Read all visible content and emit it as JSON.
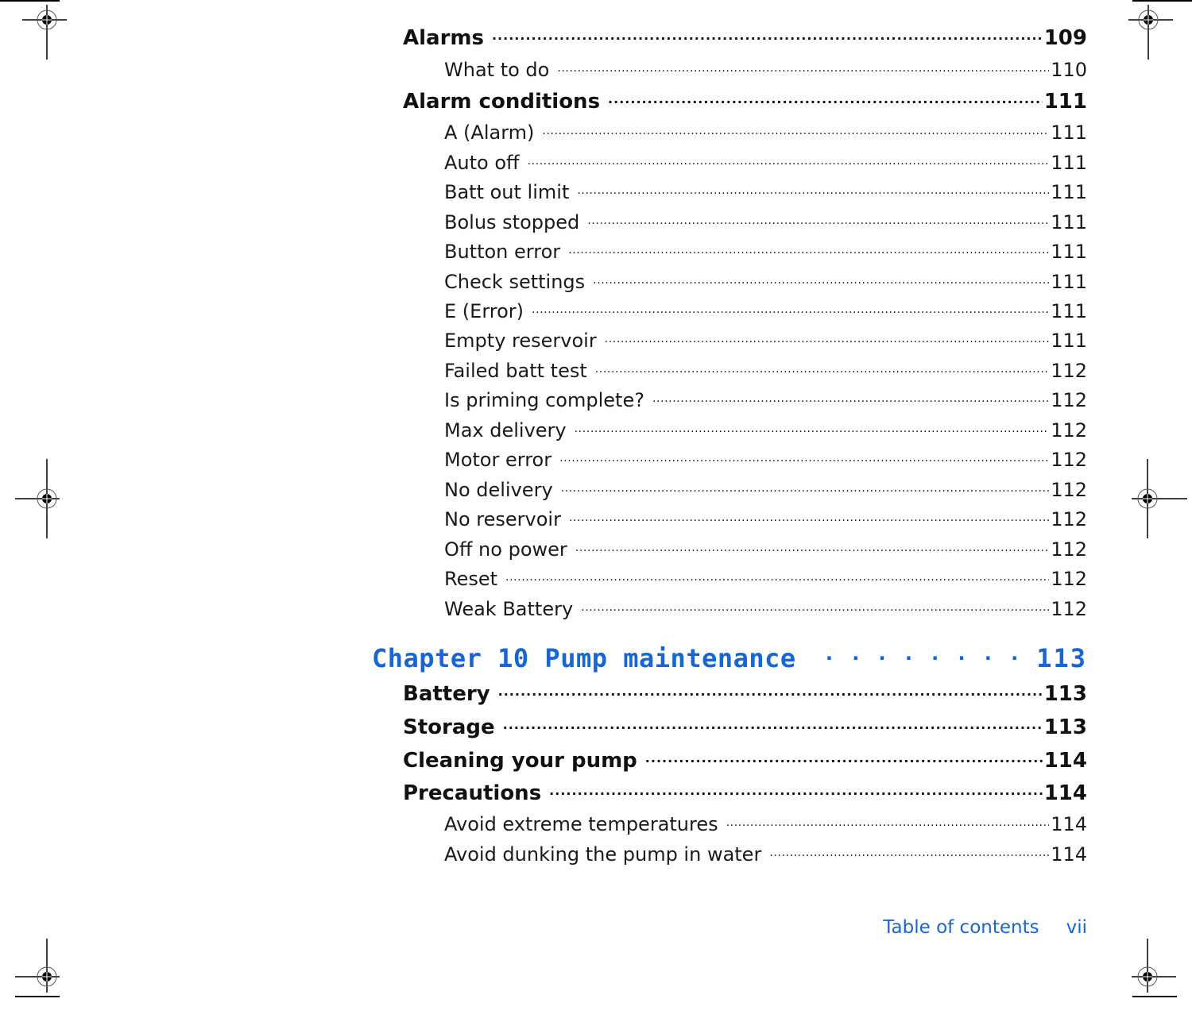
{
  "toc": {
    "sections_before": [
      {
        "level": 1,
        "title": "Alarms",
        "page": "109"
      },
      {
        "level": 2,
        "title": "What to do",
        "page": "110"
      },
      {
        "level": 1,
        "title": "Alarm conditions",
        "page": "111"
      },
      {
        "level": 2,
        "title": "A (Alarm)",
        "page": "111"
      },
      {
        "level": 2,
        "title": "Auto off",
        "page": "111"
      },
      {
        "level": 2,
        "title": "Batt out limit",
        "page": "111"
      },
      {
        "level": 2,
        "title": "Bolus stopped",
        "page": "111"
      },
      {
        "level": 2,
        "title": "Button error",
        "page": "111"
      },
      {
        "level": 2,
        "title": "Check settings",
        "page": "111"
      },
      {
        "level": 2,
        "title": "E (Error)",
        "page": "111"
      },
      {
        "level": 2,
        "title": "Empty reservoir",
        "page": "111"
      },
      {
        "level": 2,
        "title": "Failed batt test",
        "page": "112"
      },
      {
        "level": 2,
        "title": "Is priming complete?",
        "page": "112"
      },
      {
        "level": 2,
        "title": "Max delivery",
        "page": "112"
      },
      {
        "level": 2,
        "title": "Motor error",
        "page": "112"
      },
      {
        "level": 2,
        "title": "No delivery",
        "page": "112"
      },
      {
        "level": 2,
        "title": "No reservoir",
        "page": "112"
      },
      {
        "level": 2,
        "title": "Off no power",
        "page": "112"
      },
      {
        "level": 2,
        "title": "Reset",
        "page": "112"
      },
      {
        "level": 2,
        "title": "Weak Battery",
        "page": "112"
      }
    ],
    "chapter": {
      "title": "Chapter 10 Pump maintenance",
      "page": "113"
    },
    "sections_after": [
      {
        "level": 1,
        "title": "Battery",
        "page": "113"
      },
      {
        "level": 1,
        "title": "Storage",
        "page": "113"
      },
      {
        "level": 1,
        "title": "Cleaning your pump",
        "page": "114"
      },
      {
        "level": 1,
        "title": "Precautions",
        "page": "114"
      },
      {
        "level": 2,
        "title": "Avoid extreme temperatures",
        "page": "114"
      },
      {
        "level": 2,
        "title": "Avoid dunking the pump in water",
        "page": "114"
      }
    ]
  },
  "footer": {
    "section_label": "Table of contents",
    "page_number": "vii"
  },
  "colors": {
    "accent": "#1766d4",
    "text": "#111111"
  }
}
